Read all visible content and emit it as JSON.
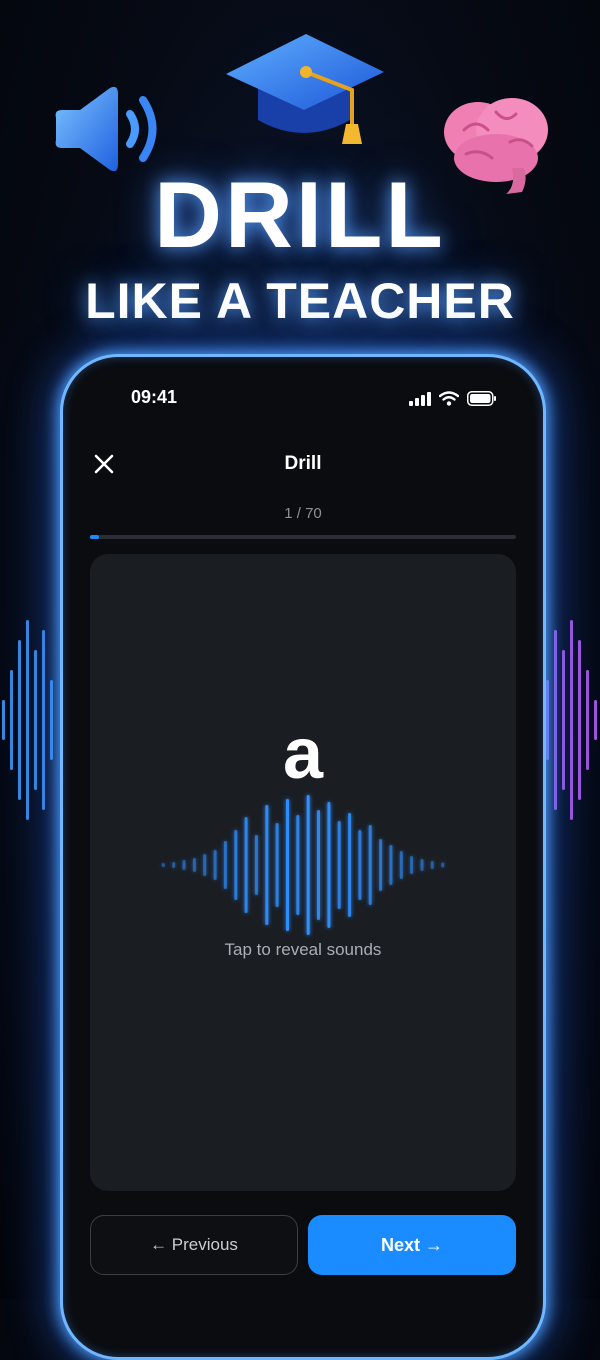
{
  "promo": {
    "headline": "DRILL",
    "subheadline": "LIKE A TEACHER",
    "icons": [
      "speaker-icon",
      "graduation-cap-icon",
      "brain-icon"
    ]
  },
  "status_bar": {
    "time": "09:41",
    "icons": [
      "cellular-signal-icon",
      "wifi-icon",
      "battery-icon"
    ]
  },
  "nav": {
    "close_icon": "close-icon",
    "title": "Drill"
  },
  "progress": {
    "label": "1 / 70",
    "current": 1,
    "total": 70
  },
  "card": {
    "letter": "a",
    "hint": "Tap to reveal sounds",
    "decoration": "sound-wave-icon"
  },
  "buttons": {
    "previous_label": "← Previous",
    "next_label": "Next →"
  },
  "colors": {
    "accent": "#1a8cff",
    "glow": "#6fb8ff",
    "card_bg": "#1a1d22",
    "background": "#060a14"
  }
}
